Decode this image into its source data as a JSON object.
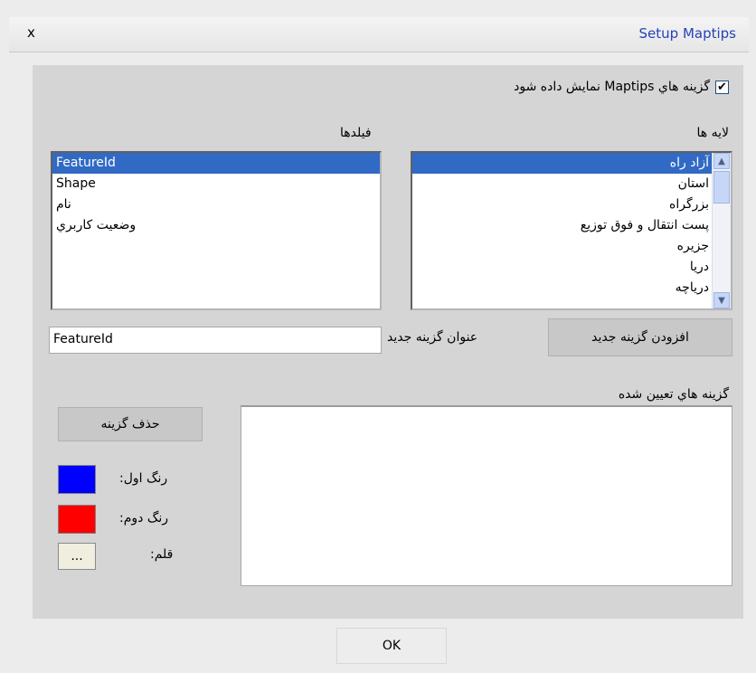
{
  "window": {
    "title": "Setup Maptips",
    "close_label": "x"
  },
  "show_maptips": {
    "label": "گزينه هاي Maptips نمايش داده شود",
    "checked": true,
    "check_glyph": "✔"
  },
  "layers": {
    "label": "لايه ها",
    "items": [
      "آزاد راه",
      "استان",
      "بزرگراه",
      "پست انتقال و فوق توزيع",
      "جزيره",
      "دريا",
      "درياچه"
    ],
    "selected_index": 0
  },
  "fields": {
    "label": "فيلدها",
    "items": [
      "FeatureId",
      "Shape",
      "نام",
      "وضعيت کاربري"
    ],
    "selected_index": 0
  },
  "new_option": {
    "add_button": "افزودن گزينه جديد",
    "title_label": "عنوان گزينه جديد",
    "title_value": "FeatureId"
  },
  "assigned": {
    "label": "گزينه هاي تعيين شده",
    "items": []
  },
  "delete_button": "حذف گزينه",
  "colors": {
    "first_label": "رنگ اول:",
    "first_color": "#0000ff",
    "second_label": "رنگ دوم:",
    "second_color": "#ff0000"
  },
  "pen": {
    "label": "قلم:",
    "button": "..."
  },
  "ok_button": "OK"
}
